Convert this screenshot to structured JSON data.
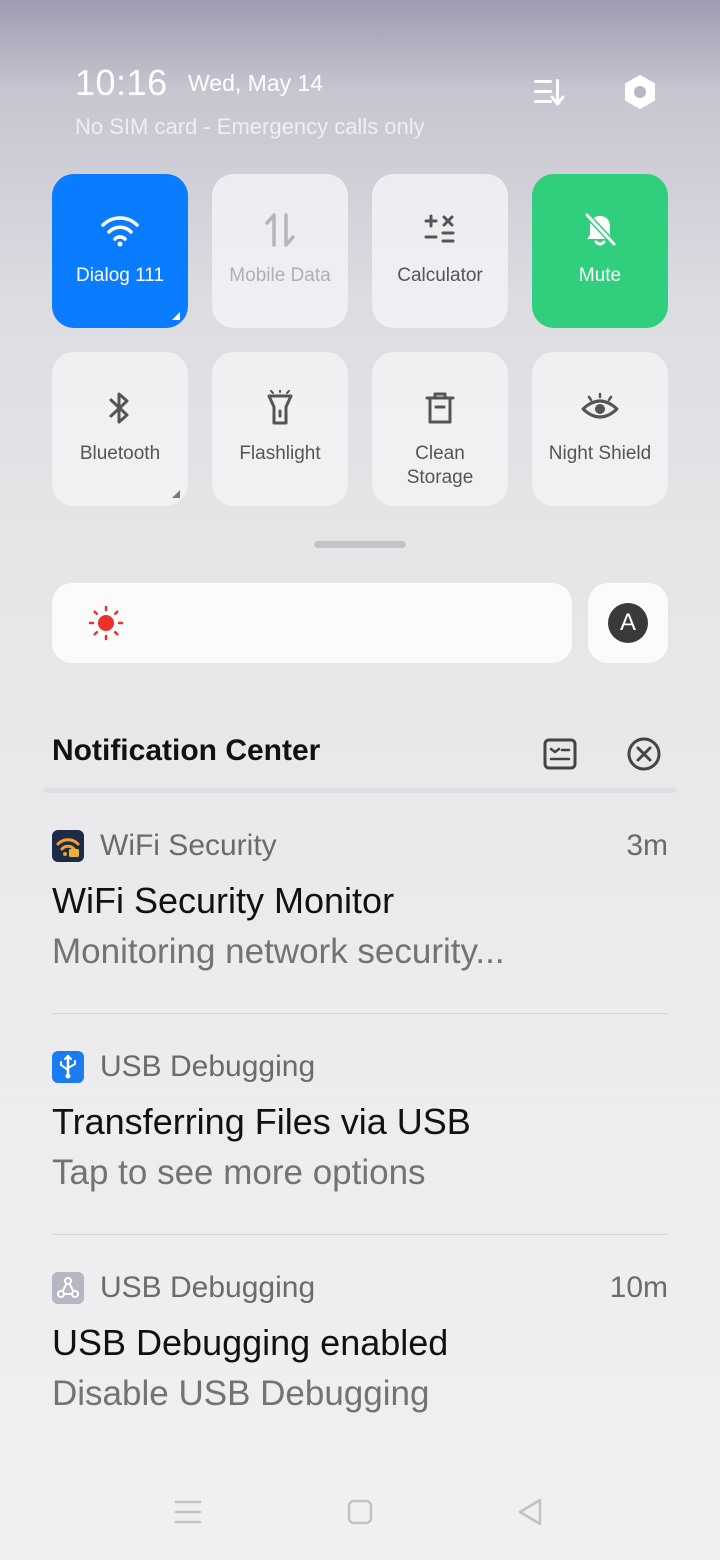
{
  "header": {
    "time": "10:16",
    "date": "Wed, May 14",
    "sim_status": "No SIM card - Emergency calls only",
    "edit_icon": "edit-order-icon",
    "settings_icon": "settings-icon"
  },
  "tiles": [
    {
      "label": "Dialog 111",
      "icon": "wifi-icon",
      "state": "active-blue"
    },
    {
      "label": "Mobile Data",
      "icon": "mobile-data-icon",
      "state": "disabled"
    },
    {
      "label": "Calculator",
      "icon": "calculator-icon",
      "state": "normal"
    },
    {
      "label": "Mute",
      "icon": "bell-off-icon",
      "state": "active-green"
    },
    {
      "label": "Bluetooth",
      "icon": "bluetooth-icon",
      "state": "normal"
    },
    {
      "label": "Flashlight",
      "icon": "flashlight-icon",
      "state": "normal"
    },
    {
      "label": "Clean Storage",
      "icon": "trash-icon",
      "state": "normal"
    },
    {
      "label": "Night Shield",
      "icon": "eye-icon",
      "state": "normal"
    }
  ],
  "brightness": {
    "icon": "sun-icon",
    "auto_label": "A"
  },
  "notification_center": {
    "title": "Notification Center",
    "notifications": [
      {
        "app": "WiFi Security",
        "time": "3m",
        "title": "WiFi Security Monitor",
        "text": "Monitoring network security..."
      },
      {
        "app": "USB Debugging",
        "time": "",
        "title": "Transferring Files via USB",
        "text": "Tap to see more options"
      },
      {
        "app": "USB Debugging",
        "time": "10m",
        "title": "USB Debugging enabled",
        "text": "Disable USB Debugging"
      }
    ]
  },
  "colors": {
    "accent_blue": "#0a7cff",
    "accent_green": "#2fcf7d",
    "sun_red": "#e8322b"
  }
}
